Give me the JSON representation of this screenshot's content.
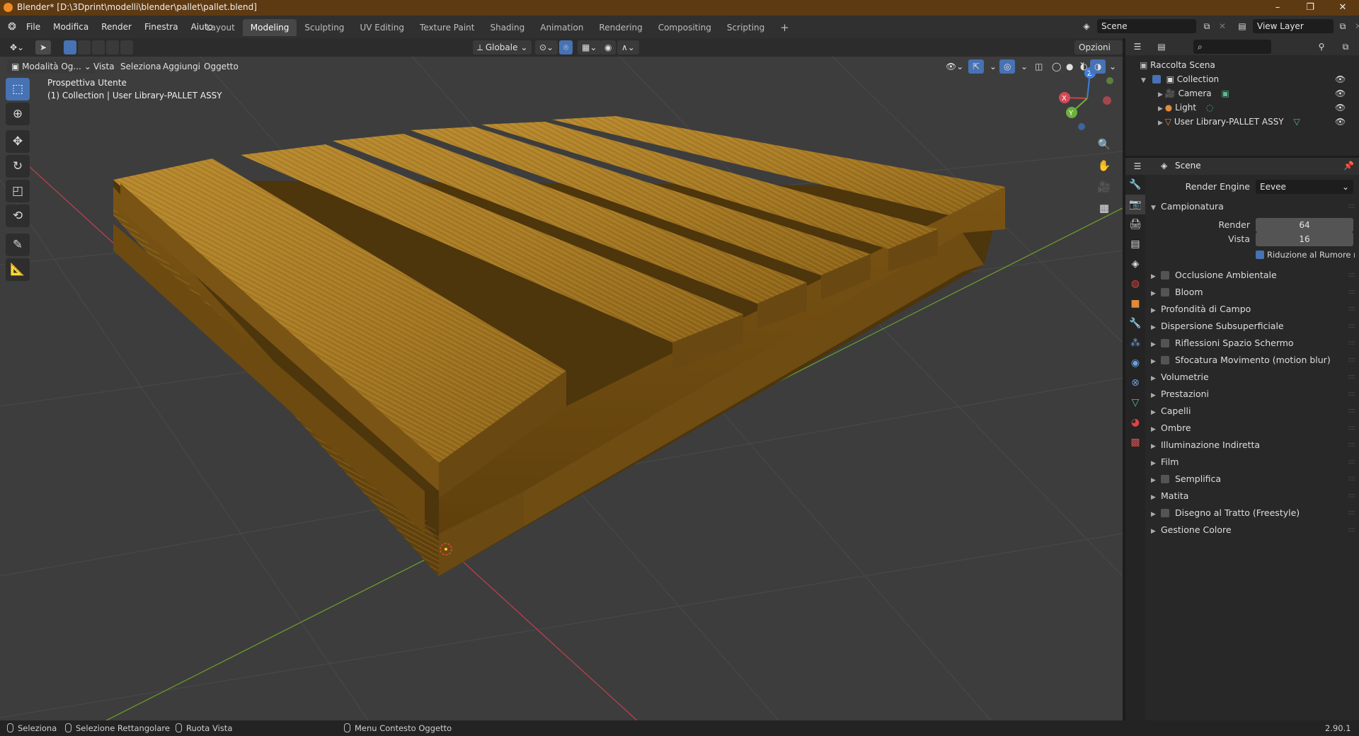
{
  "window": {
    "title": "Blender* [D:\\3Dprint\\modelli\\blender\\pallet\\pallet.blend]",
    "controls": {
      "minimize": "–",
      "maximize": "❐",
      "close": "✕"
    }
  },
  "topbar": {
    "menus": [
      "File",
      "Modifica",
      "Render",
      "Finestra",
      "Aiuto"
    ],
    "workspaces": [
      "Layout",
      "Modeling",
      "Sculpting",
      "UV Editing",
      "Texture Paint",
      "Shading",
      "Animation",
      "Rendering",
      "Compositing",
      "Scripting"
    ],
    "active_workspace": "Modeling",
    "add_workspace": "+",
    "scene_name": "Scene",
    "view_layer": "View Layer"
  },
  "viewport_header": {
    "orientation": "Globale",
    "options": "Opzioni",
    "mode": "Modalità Og...",
    "menus": [
      "Vista",
      "Seleziona",
      "Aggiungi",
      "Oggetto"
    ]
  },
  "viewport": {
    "view_name": "Prospettiva Utente",
    "collection_info": "(1) Collection | User Library-PALLET ASSY",
    "gizmo": {
      "x": "X",
      "y": "Y",
      "z": "Z"
    }
  },
  "toolbar": [
    "select-box-icon",
    "cursor-icon",
    "move-icon",
    "rotate-icon",
    "scale-icon",
    "transform-icon",
    "annotate-icon",
    "measure-icon"
  ],
  "outliner": {
    "root": "Raccolta Scena",
    "items": [
      {
        "label": "Collection",
        "indent": 1
      },
      {
        "label": "Camera",
        "indent": 2
      },
      {
        "label": "Light",
        "indent": 2
      },
      {
        "label": "User Library-PALLET ASSY",
        "indent": 2
      }
    ]
  },
  "properties": {
    "context": "Scene",
    "render_engine_label": "Render Engine",
    "render_engine_value": "Eevee",
    "sampling": {
      "title": "Campionatura",
      "render_label": "Render",
      "render_value": "64",
      "viewport_label": "Vista",
      "viewport_value": "16",
      "denoise_label": "Riduzione al Rumore nella vi..."
    },
    "panels": [
      {
        "label": "Occlusione Ambientale",
        "checkbox": true
      },
      {
        "label": "Bloom",
        "checkbox": true
      },
      {
        "label": "Profondità di Campo",
        "checkbox": false
      },
      {
        "label": "Dispersione Subsuperficiale",
        "checkbox": false
      },
      {
        "label": "Riflessioni Spazio Schermo",
        "checkbox": true
      },
      {
        "label": "Sfocatura Movimento (motion blur)",
        "checkbox": true
      },
      {
        "label": "Volumetrie",
        "checkbox": false
      },
      {
        "label": "Prestazioni",
        "checkbox": false
      },
      {
        "label": "Capelli",
        "checkbox": false
      },
      {
        "label": "Ombre",
        "checkbox": false
      },
      {
        "label": "Illuminazione Indiretta",
        "checkbox": false
      },
      {
        "label": "Film",
        "checkbox": false
      },
      {
        "label": "Semplifica",
        "checkbox": true
      },
      {
        "label": "Matita",
        "checkbox": false
      },
      {
        "label": "Disegno al Tratto (Freestyle)",
        "checkbox": true
      },
      {
        "label": "Gestione Colore",
        "checkbox": false
      }
    ]
  },
  "statusbar": {
    "select": "Seleziona",
    "box_select": "Selezione Rettangolare",
    "rotate_view": "Ruota Vista",
    "context_menu": "Menu Contesto Oggetto",
    "version": "2.90.1"
  },
  "colors": {
    "accent": "#4772b3",
    "title_bar": "#5e3a12",
    "wood": "#9a6e1c"
  }
}
